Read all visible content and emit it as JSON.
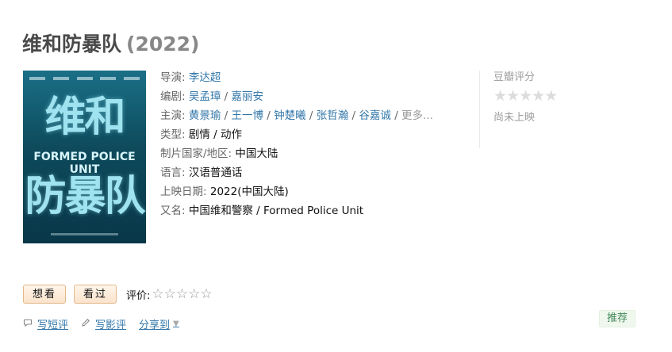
{
  "title": {
    "name": "维和防暴队",
    "year": "(2022)"
  },
  "poster": {
    "big_top": "维和",
    "mid": "FORMED POLICE UNIT",
    "big_bottom": "防暴队"
  },
  "info": {
    "director_label": "导演",
    "director": "李达超",
    "writer_label": "编剧",
    "writers": [
      "吴孟璋",
      "嘉丽安"
    ],
    "cast_label": "主演",
    "cast": [
      "黄景瑜",
      "王一博",
      "钟楚曦",
      "张哲瀚",
      "谷嘉诚"
    ],
    "cast_more": "更多...",
    "genre_label": "类型:",
    "genre": "剧情 / 动作",
    "country_label": "制片国家/地区:",
    "country": "中国大陆",
    "language_label": "语言:",
    "language": "汉语普通话",
    "release_label": "上映日期:",
    "release": "2022(中国大陆)",
    "aka_label": "又名:",
    "aka": "中国维和警察 / Formed Police Unit"
  },
  "rating": {
    "label": "豆瓣评分",
    "stars": "★★★★★",
    "status": "尚未上映"
  },
  "actions": {
    "want": "想看",
    "seen": "看过",
    "rate_label": "评价:",
    "my_stars": "☆☆☆☆☆"
  },
  "bottom": {
    "short_review": "写短评",
    "review": "写影评",
    "share": "分享到",
    "recommend": "推荐"
  },
  "icons": {
    "comment": "comment-icon",
    "pencil": "pencil-icon",
    "caret": "caret-down-icon"
  }
}
